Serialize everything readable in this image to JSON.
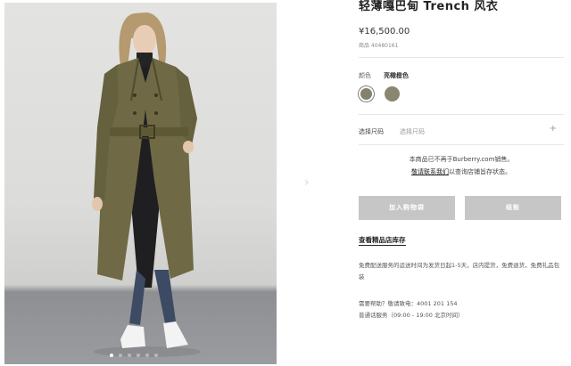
{
  "product": {
    "title": "轻薄嘎巴甸 Trench 风衣",
    "price": "¥16,500.00",
    "sku": "商品 40480161"
  },
  "color": {
    "label": "颜色",
    "value": "亮橄榄色",
    "swatches": [
      "#85826b",
      "#8a8670"
    ]
  },
  "size": {
    "label": "选择尺码",
    "placeholder": "选择尺码",
    "expand_icon": "+"
  },
  "notice": {
    "line1": "本商品已不再于Burberry.com销售。",
    "line2_link": "敬请联系我们",
    "line2_rest": "以查询店铺旨存状态。"
  },
  "buttons": {
    "add_to_bag": "加入购物袋",
    "checkout": "结账"
  },
  "store_link": "查看精品店库存",
  "shipping": {
    "text": "免费配送服务的运送时间为发货日起1-5天，店内提货，免费退货，免费礼品包装"
  },
  "help": {
    "phone_line": "需要帮助？敬请致电：4001 201 154",
    "hours_line": "普通话服务（09:00 - 19:00 北京时间）"
  },
  "gallery": {
    "dots": 6,
    "active_index": 0
  }
}
